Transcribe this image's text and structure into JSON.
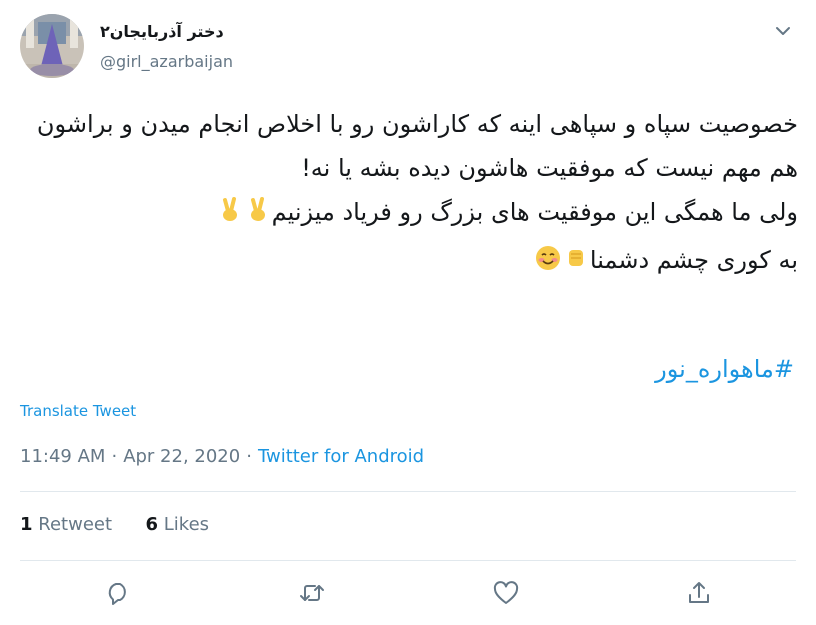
{
  "user": {
    "display_name": "دختر آذربایجان۲",
    "handle": "@girl_azarbaijan",
    "avatar_icon": "avatar-image"
  },
  "tweet": {
    "lines": [
      "خصوصیت سپاه و سپاهی اینه که کاراشون رو با اخلاص انجام میدن و براشون هم مهم نیست که موفقیت هاشون دیده بشه یا نه!",
      "ولی ما همگی این موفقیت های بزرگ رو فریاد میزنیم",
      "به کوری چشم دشمنا"
    ],
    "hashtag": "#ماهواره_نور"
  },
  "translate_label": "Translate Tweet",
  "meta": {
    "time": "11:49 AM",
    "separator": "·",
    "date": "Apr 22, 2020",
    "source": "Twitter for Android"
  },
  "stats": {
    "retweets_count": "1",
    "retweets_label": "Retweet",
    "likes_count": "6",
    "likes_label": "Likes"
  },
  "actions": [
    "reply-icon",
    "retweet-icon",
    "like-icon",
    "share-icon"
  ],
  "colors": {
    "link": "#1b95e0",
    "muted": "#657786",
    "text": "#14171a",
    "divider": "#e1e8ed",
    "emoji": "#f7c948"
  }
}
